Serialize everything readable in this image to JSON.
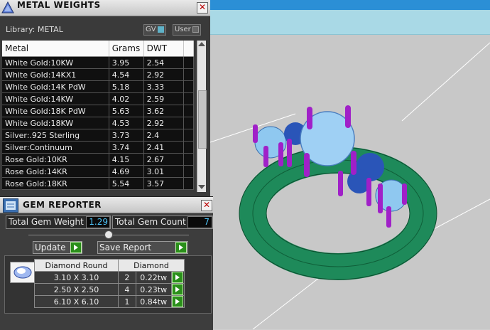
{
  "metal_weights": {
    "title": "METAL WEIGHTS",
    "close": "✕",
    "library_label": "Library: METAL",
    "gv_label": "GV",
    "user_label": "User",
    "columns": [
      "Metal",
      "Grams",
      "DWT"
    ],
    "rows": [
      [
        "White Gold:10KW",
        "3.95",
        "2.54"
      ],
      [
        "White Gold:14KX1",
        "4.54",
        "2.92"
      ],
      [
        "White Gold:14K PdW",
        "5.18",
        "3.33"
      ],
      [
        "White Gold:14KW",
        "4.02",
        "2.59"
      ],
      [
        "White Gold:18K PdW",
        "5.63",
        "3.62"
      ],
      [
        "White Gold:18KW",
        "4.53",
        "2.92"
      ],
      [
        "Silver:.925 Sterling",
        "3.73",
        "2.4"
      ],
      [
        "Silver:Continuum",
        "3.74",
        "2.41"
      ],
      [
        "Rose Gold:10KR",
        "4.15",
        "2.67"
      ],
      [
        "Rose Gold:14KR",
        "4.69",
        "3.01"
      ],
      [
        "Rose Gold:18KR",
        "5.54",
        "3.57"
      ]
    ]
  },
  "gem_reporter": {
    "title": "GEM REPORTER",
    "close": "✕",
    "total_weight_label": "Total Gem Weight",
    "total_weight_value": "1.29",
    "total_count_label": "Total Gem Count",
    "total_count_value": "7",
    "update_label": "Update",
    "save_report_label": "Save Report",
    "columns": [
      "Diamond Round",
      "",
      "Diamond"
    ],
    "rows": [
      [
        "3.10 X 3.10",
        "2",
        "0.22tw"
      ],
      [
        "2.50 X 2.50",
        "4",
        "0.23tw"
      ],
      [
        "6.10 X 6.10",
        "1",
        "0.84tw"
      ]
    ]
  },
  "colors": {
    "viewport_bg": "#c8c8c8",
    "viewport_header": "#a9d9e6",
    "ring_band": "#1e8a5a",
    "prongs": "#a020c8",
    "gem_light": "#8fc8f0",
    "gem_dark": "#2a55b8",
    "value_text": "#4fc3f7"
  }
}
